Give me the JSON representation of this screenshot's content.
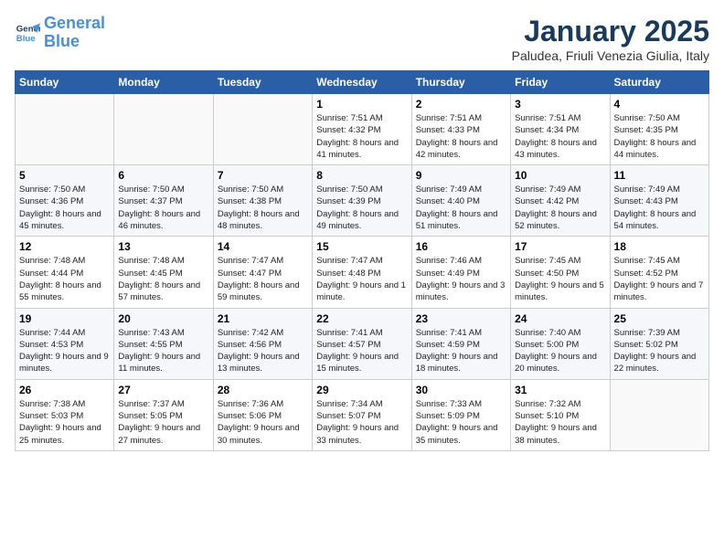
{
  "logo": {
    "line1": "General",
    "line2": "Blue"
  },
  "title": "January 2025",
  "subtitle": "Paludea, Friuli Venezia Giulia, Italy",
  "weekdays": [
    "Sunday",
    "Monday",
    "Tuesday",
    "Wednesday",
    "Thursday",
    "Friday",
    "Saturday"
  ],
  "weeks": [
    [
      {
        "day": "",
        "info": ""
      },
      {
        "day": "",
        "info": ""
      },
      {
        "day": "",
        "info": ""
      },
      {
        "day": "1",
        "info": "Sunrise: 7:51 AM\nSunset: 4:32 PM\nDaylight: 8 hours and 41 minutes."
      },
      {
        "day": "2",
        "info": "Sunrise: 7:51 AM\nSunset: 4:33 PM\nDaylight: 8 hours and 42 minutes."
      },
      {
        "day": "3",
        "info": "Sunrise: 7:51 AM\nSunset: 4:34 PM\nDaylight: 8 hours and 43 minutes."
      },
      {
        "day": "4",
        "info": "Sunrise: 7:50 AM\nSunset: 4:35 PM\nDaylight: 8 hours and 44 minutes."
      }
    ],
    [
      {
        "day": "5",
        "info": "Sunrise: 7:50 AM\nSunset: 4:36 PM\nDaylight: 8 hours and 45 minutes."
      },
      {
        "day": "6",
        "info": "Sunrise: 7:50 AM\nSunset: 4:37 PM\nDaylight: 8 hours and 46 minutes."
      },
      {
        "day": "7",
        "info": "Sunrise: 7:50 AM\nSunset: 4:38 PM\nDaylight: 8 hours and 48 minutes."
      },
      {
        "day": "8",
        "info": "Sunrise: 7:50 AM\nSunset: 4:39 PM\nDaylight: 8 hours and 49 minutes."
      },
      {
        "day": "9",
        "info": "Sunrise: 7:49 AM\nSunset: 4:40 PM\nDaylight: 8 hours and 51 minutes."
      },
      {
        "day": "10",
        "info": "Sunrise: 7:49 AM\nSunset: 4:42 PM\nDaylight: 8 hours and 52 minutes."
      },
      {
        "day": "11",
        "info": "Sunrise: 7:49 AM\nSunset: 4:43 PM\nDaylight: 8 hours and 54 minutes."
      }
    ],
    [
      {
        "day": "12",
        "info": "Sunrise: 7:48 AM\nSunset: 4:44 PM\nDaylight: 8 hours and 55 minutes."
      },
      {
        "day": "13",
        "info": "Sunrise: 7:48 AM\nSunset: 4:45 PM\nDaylight: 8 hours and 57 minutes."
      },
      {
        "day": "14",
        "info": "Sunrise: 7:47 AM\nSunset: 4:47 PM\nDaylight: 8 hours and 59 minutes."
      },
      {
        "day": "15",
        "info": "Sunrise: 7:47 AM\nSunset: 4:48 PM\nDaylight: 9 hours and 1 minute."
      },
      {
        "day": "16",
        "info": "Sunrise: 7:46 AM\nSunset: 4:49 PM\nDaylight: 9 hours and 3 minutes."
      },
      {
        "day": "17",
        "info": "Sunrise: 7:45 AM\nSunset: 4:50 PM\nDaylight: 9 hours and 5 minutes."
      },
      {
        "day": "18",
        "info": "Sunrise: 7:45 AM\nSunset: 4:52 PM\nDaylight: 9 hours and 7 minutes."
      }
    ],
    [
      {
        "day": "19",
        "info": "Sunrise: 7:44 AM\nSunset: 4:53 PM\nDaylight: 9 hours and 9 minutes."
      },
      {
        "day": "20",
        "info": "Sunrise: 7:43 AM\nSunset: 4:55 PM\nDaylight: 9 hours and 11 minutes."
      },
      {
        "day": "21",
        "info": "Sunrise: 7:42 AM\nSunset: 4:56 PM\nDaylight: 9 hours and 13 minutes."
      },
      {
        "day": "22",
        "info": "Sunrise: 7:41 AM\nSunset: 4:57 PM\nDaylight: 9 hours and 15 minutes."
      },
      {
        "day": "23",
        "info": "Sunrise: 7:41 AM\nSunset: 4:59 PM\nDaylight: 9 hours and 18 minutes."
      },
      {
        "day": "24",
        "info": "Sunrise: 7:40 AM\nSunset: 5:00 PM\nDaylight: 9 hours and 20 minutes."
      },
      {
        "day": "25",
        "info": "Sunrise: 7:39 AM\nSunset: 5:02 PM\nDaylight: 9 hours and 22 minutes."
      }
    ],
    [
      {
        "day": "26",
        "info": "Sunrise: 7:38 AM\nSunset: 5:03 PM\nDaylight: 9 hours and 25 minutes."
      },
      {
        "day": "27",
        "info": "Sunrise: 7:37 AM\nSunset: 5:05 PM\nDaylight: 9 hours and 27 minutes."
      },
      {
        "day": "28",
        "info": "Sunrise: 7:36 AM\nSunset: 5:06 PM\nDaylight: 9 hours and 30 minutes."
      },
      {
        "day": "29",
        "info": "Sunrise: 7:34 AM\nSunset: 5:07 PM\nDaylight: 9 hours and 33 minutes."
      },
      {
        "day": "30",
        "info": "Sunrise: 7:33 AM\nSunset: 5:09 PM\nDaylight: 9 hours and 35 minutes."
      },
      {
        "day": "31",
        "info": "Sunrise: 7:32 AM\nSunset: 5:10 PM\nDaylight: 9 hours and 38 minutes."
      },
      {
        "day": "",
        "info": ""
      }
    ]
  ]
}
